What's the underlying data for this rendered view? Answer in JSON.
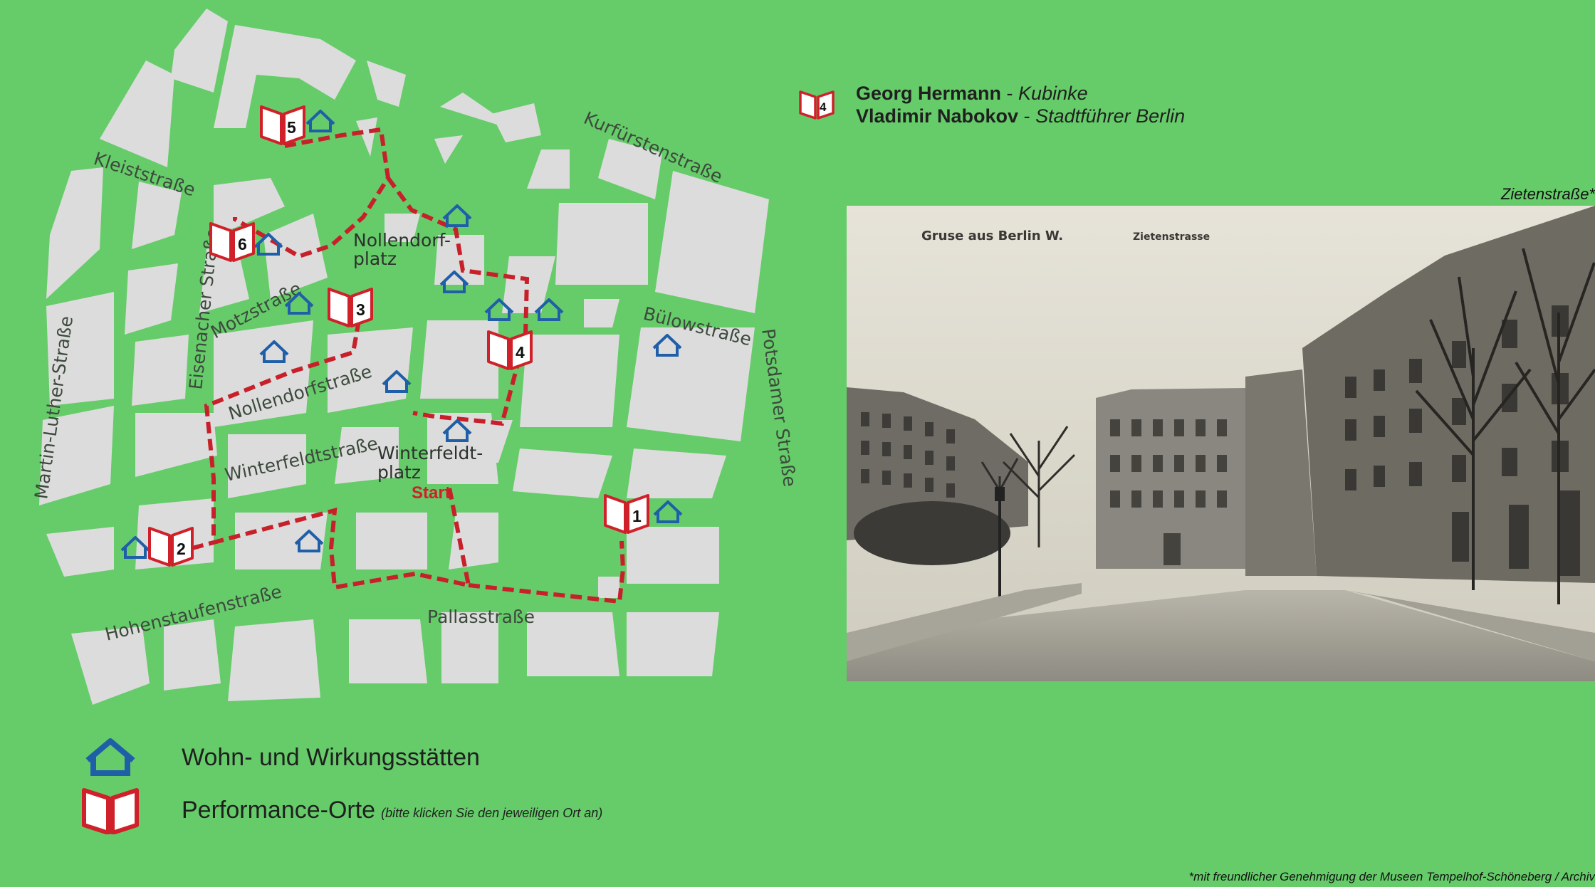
{
  "map": {
    "streets": {
      "kleiststrasse": "Kleiststraße",
      "kurfuerstenstrasse": "Kurfürstenstraße",
      "eisenacher_strasse": "Eisenacher Straße",
      "motzstrasse": "Motzstraße",
      "buelowstrasse": "Bülowstraße",
      "potsdamer_strasse": "Potsdamer Straße",
      "martin_luther_strasse": "Martin-Luther-Straße",
      "nollendorfstrasse": "Nollendorfstraße",
      "winterfeldtstrasse": "Winterfeldtstraße",
      "hohenstaufenstrasse": "Hohenstaufenstraße",
      "pallasstrasse": "Pallasstraße"
    },
    "places": {
      "nollendorfplatz_line1": "Nollendorf-",
      "nollendorfplatz_line2": "platz",
      "winterfeldtplatz_line1": "Winterfeldt-",
      "winterfeldtplatz_line2": "platz"
    },
    "start_label": "Start",
    "performance_sites": [
      {
        "number": "1"
      },
      {
        "number": "2"
      },
      {
        "number": "3"
      },
      {
        "number": "4"
      },
      {
        "number": "5"
      },
      {
        "number": "6"
      }
    ],
    "colors": {
      "background": "#66cc6a",
      "blocks": "#dcdcdc",
      "route": "#c8202a",
      "house_icon": "#1f5fa8",
      "book_icon": "#d0202a"
    }
  },
  "legend": {
    "residences_label": "Wohn- und Wirkungsstätten",
    "performance_label": "Performance-Orte",
    "performance_note": "(bitte klicken Sie den jeweiligen Ort an)"
  },
  "info": {
    "marker_number": "4",
    "line1_author": "Georg Hermann",
    "line1_separator": " - ",
    "line1_work": "Kubinke",
    "line2_author": "Vladimir Nabokov",
    "line2_separator": " - ",
    "line2_work": "Stadtführer Berlin"
  },
  "photo": {
    "caption": "Zietenstraße*",
    "postcard_greeting": "Gruse aus Berlin W.",
    "postcard_street": "Zietenstrasse"
  },
  "credit": "*mit freundlicher Genehmigung der Museen Tempelhof-Schöneberg / Archiv"
}
